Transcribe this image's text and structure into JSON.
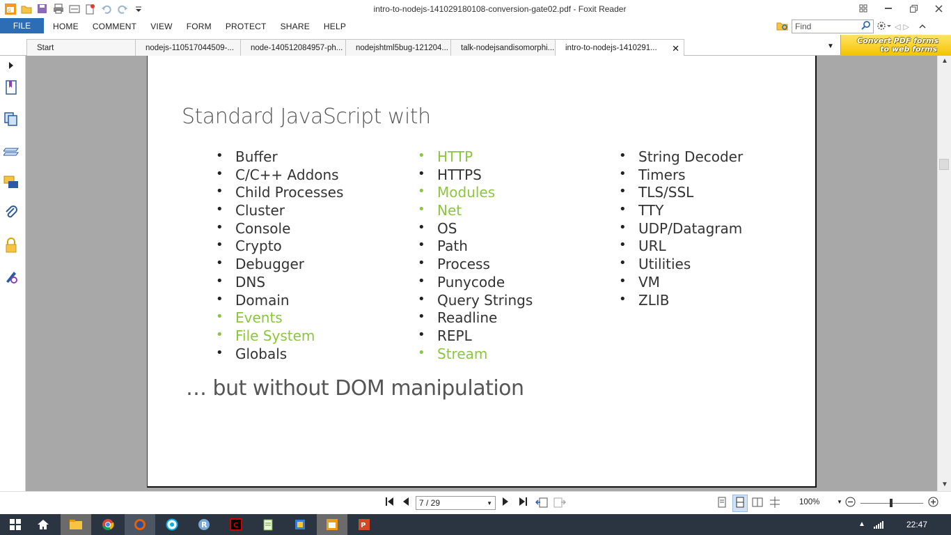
{
  "window": {
    "title": "intro-to-nodejs-141029180108-conversion-gate02.pdf - Foxit Reader",
    "quick_access_icons": [
      "foxit-logo-icon",
      "open-folder-icon",
      "save-icon",
      "print-icon",
      "scan-icon",
      "new-doc-icon",
      "undo-icon",
      "redo-icon",
      "customize-dropdown-icon"
    ],
    "controls": [
      "restore-down-icon",
      "minimize-icon",
      "maximize-icon",
      "close-icon"
    ]
  },
  "ribbon": {
    "file_label": "FILE",
    "menus": [
      "HOME",
      "COMMENT",
      "VIEW",
      "FORM",
      "PROTECT",
      "SHARE",
      "HELP"
    ],
    "find_placeholder": "Find"
  },
  "tabs": [
    {
      "label": "Start",
      "active": false
    },
    {
      "label": "nodejs-110517044509-...",
      "active": false
    },
    {
      "label": "node-140512084957-ph...",
      "active": false
    },
    {
      "label": "nodejshtml5bug-121204...",
      "active": false
    },
    {
      "label": "talk-nodejsandisomorphi...",
      "active": false
    },
    {
      "label": "intro-to-nodejs-1410291...",
      "active": true
    }
  ],
  "ad": {
    "line1": "Convert PDF forms",
    "line2": "to web forms"
  },
  "left_panel_icons": [
    "expand-arrow-icon",
    "bookmark-icon",
    "pages-icon",
    "layers-icon",
    "comments-icon",
    "attachments-icon",
    "security-icon",
    "signature-icon"
  ],
  "slide": {
    "title": "Standard JavaScript with",
    "highlight_color": "#8cc63f",
    "columns": [
      [
        {
          "text": "Buffer",
          "hl": false
        },
        {
          "text": "C/C++ Addons",
          "hl": false
        },
        {
          "text": "Child Processes",
          "hl": false
        },
        {
          "text": "Cluster",
          "hl": false
        },
        {
          "text": "Console",
          "hl": false
        },
        {
          "text": "Crypto",
          "hl": false
        },
        {
          "text": "Debugger",
          "hl": false
        },
        {
          "text": "DNS",
          "hl": false
        },
        {
          "text": "Domain",
          "hl": false
        },
        {
          "text": "Events",
          "hl": true
        },
        {
          "text": "File System",
          "hl": true
        },
        {
          "text": "Globals",
          "hl": false
        }
      ],
      [
        {
          "text": "HTTP",
          "hl": true
        },
        {
          "text": "HTTPS",
          "hl": false
        },
        {
          "text": "Modules",
          "hl": true
        },
        {
          "text": "Net",
          "hl": true
        },
        {
          "text": "OS",
          "hl": false
        },
        {
          "text": "Path",
          "hl": false
        },
        {
          "text": "Process",
          "hl": false
        },
        {
          "text": "Punycode",
          "hl": false
        },
        {
          "text": "Query Strings",
          "hl": false
        },
        {
          "text": "Readline",
          "hl": false
        },
        {
          "text": "REPL",
          "hl": false
        },
        {
          "text": "Stream",
          "hl": true
        }
      ],
      [
        {
          "text": "String Decoder",
          "hl": false
        },
        {
          "text": "Timers",
          "hl": false
        },
        {
          "text": "TLS/SSL",
          "hl": false
        },
        {
          "text": "TTY",
          "hl": false
        },
        {
          "text": "UDP/Datagram",
          "hl": false
        },
        {
          "text": "URL",
          "hl": false
        },
        {
          "text": "Utilities",
          "hl": false
        },
        {
          "text": "VM",
          "hl": false
        },
        {
          "text": "ZLIB",
          "hl": false
        }
      ]
    ],
    "footer": "… but without DOM manipulation"
  },
  "navigation": {
    "page_value": "7 / 29",
    "zoom": "100%"
  },
  "taskbar": {
    "items": [
      "windows-start-icon",
      "home-icon",
      "file-explorer-icon",
      "chrome-icon",
      "firefox-icon",
      "skype-icon",
      "r-studio-icon",
      "terminal-icon",
      "notepad-icon",
      "archive-icon",
      "foxit-reader-icon",
      "powerpoint-icon"
    ],
    "clock": "22:47"
  }
}
